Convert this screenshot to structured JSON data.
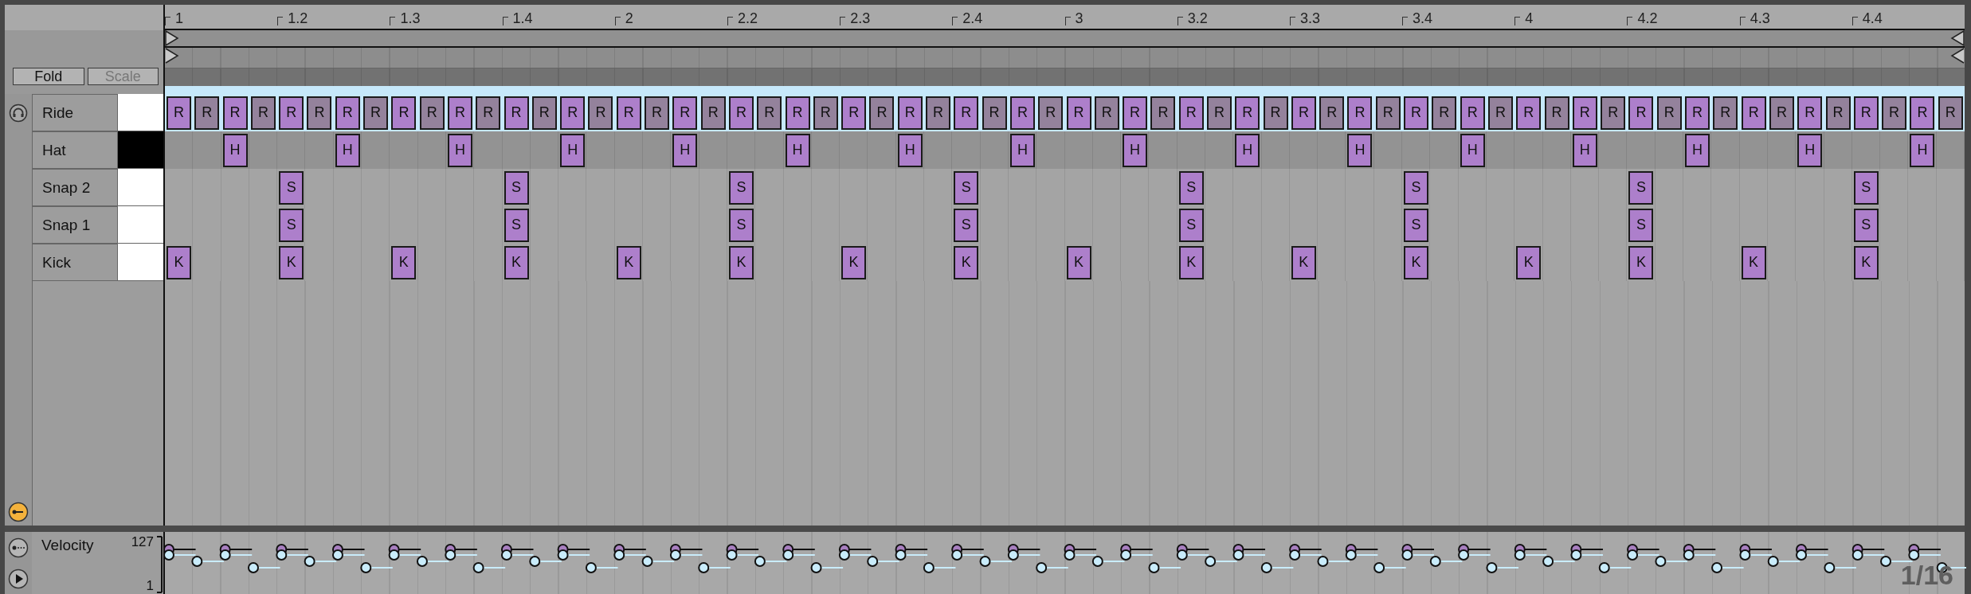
{
  "ruler": {
    "labels": [
      "1",
      "1.2",
      "1.3",
      "1.4",
      "2",
      "2.2",
      "2.3",
      "2.4",
      "3",
      "3.2",
      "3.3",
      "3.4",
      "4",
      "4.2",
      "4.3",
      "4.4"
    ]
  },
  "buttons": [
    {
      "label": "Fold",
      "disabled": false
    },
    {
      "label": "Scale",
      "disabled": true
    }
  ],
  "lanes": [
    {
      "name": "Ride",
      "kind": "white-key",
      "selected": true,
      "steps": [
        {
          "on": true,
          "label": "R",
          "dim": false
        },
        {
          "on": true,
          "label": "R",
          "dim": true
        },
        {
          "on": true,
          "label": "R",
          "dim": false
        },
        {
          "on": true,
          "label": "R",
          "dim": true
        },
        {
          "on": true,
          "label": "R",
          "dim": false
        },
        {
          "on": true,
          "label": "R",
          "dim": true
        },
        {
          "on": true,
          "label": "R",
          "dim": false
        },
        {
          "on": true,
          "label": "R",
          "dim": true
        },
        {
          "on": true,
          "label": "R",
          "dim": false
        },
        {
          "on": true,
          "label": "R",
          "dim": true
        },
        {
          "on": true,
          "label": "R",
          "dim": false
        },
        {
          "on": true,
          "label": "R",
          "dim": true
        },
        {
          "on": true,
          "label": "R",
          "dim": false
        },
        {
          "on": true,
          "label": "R",
          "dim": true
        },
        {
          "on": true,
          "label": "R",
          "dim": false
        },
        {
          "on": true,
          "label": "R",
          "dim": true
        },
        {
          "on": true,
          "label": "R",
          "dim": false
        },
        {
          "on": true,
          "label": "R",
          "dim": true
        },
        {
          "on": true,
          "label": "R",
          "dim": false
        },
        {
          "on": true,
          "label": "R",
          "dim": true
        },
        {
          "on": true,
          "label": "R",
          "dim": false
        },
        {
          "on": true,
          "label": "R",
          "dim": true
        },
        {
          "on": true,
          "label": "R",
          "dim": false
        },
        {
          "on": true,
          "label": "R",
          "dim": true
        },
        {
          "on": true,
          "label": "R",
          "dim": false
        },
        {
          "on": true,
          "label": "R",
          "dim": true
        },
        {
          "on": true,
          "label": "R",
          "dim": false
        },
        {
          "on": true,
          "label": "R",
          "dim": true
        },
        {
          "on": true,
          "label": "R",
          "dim": false
        },
        {
          "on": true,
          "label": "R",
          "dim": true
        },
        {
          "on": true,
          "label": "R",
          "dim": false
        },
        {
          "on": true,
          "label": "R",
          "dim": true
        },
        {
          "on": true,
          "label": "R",
          "dim": false
        },
        {
          "on": true,
          "label": "R",
          "dim": true
        },
        {
          "on": true,
          "label": "R",
          "dim": false
        },
        {
          "on": true,
          "label": "R",
          "dim": true
        },
        {
          "on": true,
          "label": "R",
          "dim": false
        },
        {
          "on": true,
          "label": "R",
          "dim": true
        },
        {
          "on": true,
          "label": "R",
          "dim": false
        },
        {
          "on": true,
          "label": "R",
          "dim": true
        },
        {
          "on": true,
          "label": "R",
          "dim": false
        },
        {
          "on": true,
          "label": "R",
          "dim": true
        },
        {
          "on": true,
          "label": "R",
          "dim": false
        },
        {
          "on": true,
          "label": "R",
          "dim": true
        },
        {
          "on": true,
          "label": "R",
          "dim": false
        },
        {
          "on": true,
          "label": "R",
          "dim": true
        },
        {
          "on": true,
          "label": "R",
          "dim": false
        },
        {
          "on": true,
          "label": "R",
          "dim": true
        },
        {
          "on": true,
          "label": "R",
          "dim": false
        },
        {
          "on": true,
          "label": "R",
          "dim": true
        },
        {
          "on": true,
          "label": "R",
          "dim": false
        },
        {
          "on": true,
          "label": "R",
          "dim": true
        },
        {
          "on": true,
          "label": "R",
          "dim": false
        },
        {
          "on": true,
          "label": "R",
          "dim": true
        },
        {
          "on": true,
          "label": "R",
          "dim": false
        },
        {
          "on": true,
          "label": "R",
          "dim": true
        },
        {
          "on": true,
          "label": "R",
          "dim": false
        },
        {
          "on": true,
          "label": "R",
          "dim": true
        },
        {
          "on": true,
          "label": "R",
          "dim": false
        },
        {
          "on": true,
          "label": "R",
          "dim": true
        },
        {
          "on": true,
          "label": "R",
          "dim": false
        },
        {
          "on": true,
          "label": "R",
          "dim": true
        },
        {
          "on": true,
          "label": "R",
          "dim": false
        },
        {
          "on": true,
          "label": "R",
          "dim": true
        }
      ]
    },
    {
      "name": "Hat",
      "kind": "black-key",
      "selected": false,
      "steps": [
        {
          "on": false
        },
        {
          "on": false
        },
        {
          "on": true,
          "label": "H"
        },
        {
          "on": false
        },
        {
          "on": false
        },
        {
          "on": false
        },
        {
          "on": true,
          "label": "H"
        },
        {
          "on": false
        },
        {
          "on": false
        },
        {
          "on": false
        },
        {
          "on": true,
          "label": "H"
        },
        {
          "on": false
        },
        {
          "on": false
        },
        {
          "on": false
        },
        {
          "on": true,
          "label": "H"
        },
        {
          "on": false
        },
        {
          "on": false
        },
        {
          "on": false
        },
        {
          "on": true,
          "label": "H"
        },
        {
          "on": false
        },
        {
          "on": false
        },
        {
          "on": false
        },
        {
          "on": true,
          "label": "H"
        },
        {
          "on": false
        },
        {
          "on": false
        },
        {
          "on": false
        },
        {
          "on": true,
          "label": "H"
        },
        {
          "on": false
        },
        {
          "on": false
        },
        {
          "on": false
        },
        {
          "on": true,
          "label": "H"
        },
        {
          "on": false
        },
        {
          "on": false
        },
        {
          "on": false
        },
        {
          "on": true,
          "label": "H"
        },
        {
          "on": false
        },
        {
          "on": false
        },
        {
          "on": false
        },
        {
          "on": true,
          "label": "H"
        },
        {
          "on": false
        },
        {
          "on": false
        },
        {
          "on": false
        },
        {
          "on": true,
          "label": "H"
        },
        {
          "on": false
        },
        {
          "on": false
        },
        {
          "on": false
        },
        {
          "on": true,
          "label": "H"
        },
        {
          "on": false
        },
        {
          "on": false
        },
        {
          "on": false
        },
        {
          "on": true,
          "label": "H"
        },
        {
          "on": false
        },
        {
          "on": false
        },
        {
          "on": false
        },
        {
          "on": true,
          "label": "H"
        },
        {
          "on": false
        },
        {
          "on": false
        },
        {
          "on": false
        },
        {
          "on": true,
          "label": "H"
        },
        {
          "on": false
        },
        {
          "on": false
        },
        {
          "on": false
        },
        {
          "on": true,
          "label": "H"
        },
        {
          "on": false
        }
      ]
    },
    {
      "name": "Snap 2",
      "kind": "white-key",
      "selected": false,
      "steps": [
        {
          "on": false
        },
        {
          "on": false
        },
        {
          "on": false
        },
        {
          "on": false
        },
        {
          "on": true,
          "label": "S"
        },
        {
          "on": false
        },
        {
          "on": false
        },
        {
          "on": false
        },
        {
          "on": false
        },
        {
          "on": false
        },
        {
          "on": false
        },
        {
          "on": false
        },
        {
          "on": true,
          "label": "S"
        },
        {
          "on": false
        },
        {
          "on": false
        },
        {
          "on": false
        },
        {
          "on": false
        },
        {
          "on": false
        },
        {
          "on": false
        },
        {
          "on": false
        },
        {
          "on": true,
          "label": "S"
        },
        {
          "on": false
        },
        {
          "on": false
        },
        {
          "on": false
        },
        {
          "on": false
        },
        {
          "on": false
        },
        {
          "on": false
        },
        {
          "on": false
        },
        {
          "on": true,
          "label": "S"
        },
        {
          "on": false
        },
        {
          "on": false
        },
        {
          "on": false
        },
        {
          "on": false
        },
        {
          "on": false
        },
        {
          "on": false
        },
        {
          "on": false
        },
        {
          "on": true,
          "label": "S"
        },
        {
          "on": false
        },
        {
          "on": false
        },
        {
          "on": false
        },
        {
          "on": false
        },
        {
          "on": false
        },
        {
          "on": false
        },
        {
          "on": false
        },
        {
          "on": true,
          "label": "S"
        },
        {
          "on": false
        },
        {
          "on": false
        },
        {
          "on": false
        },
        {
          "on": false
        },
        {
          "on": false
        },
        {
          "on": false
        },
        {
          "on": false
        },
        {
          "on": true,
          "label": "S"
        },
        {
          "on": false
        },
        {
          "on": false
        },
        {
          "on": false
        },
        {
          "on": false
        },
        {
          "on": false
        },
        {
          "on": false
        },
        {
          "on": false
        },
        {
          "on": true,
          "label": "S"
        },
        {
          "on": false
        },
        {
          "on": false
        },
        {
          "on": false
        }
      ]
    },
    {
      "name": "Snap 1",
      "kind": "white-key",
      "selected": false,
      "steps": [
        {
          "on": false
        },
        {
          "on": false
        },
        {
          "on": false
        },
        {
          "on": false
        },
        {
          "on": true,
          "label": "S"
        },
        {
          "on": false
        },
        {
          "on": false
        },
        {
          "on": false
        },
        {
          "on": false
        },
        {
          "on": false
        },
        {
          "on": false
        },
        {
          "on": false
        },
        {
          "on": true,
          "label": "S"
        },
        {
          "on": false
        },
        {
          "on": false
        },
        {
          "on": false
        },
        {
          "on": false
        },
        {
          "on": false
        },
        {
          "on": false
        },
        {
          "on": false
        },
        {
          "on": true,
          "label": "S"
        },
        {
          "on": false
        },
        {
          "on": false
        },
        {
          "on": false
        },
        {
          "on": false
        },
        {
          "on": false
        },
        {
          "on": false
        },
        {
          "on": false
        },
        {
          "on": true,
          "label": "S"
        },
        {
          "on": false
        },
        {
          "on": false
        },
        {
          "on": false
        },
        {
          "on": false
        },
        {
          "on": false
        },
        {
          "on": false
        },
        {
          "on": false
        },
        {
          "on": true,
          "label": "S"
        },
        {
          "on": false
        },
        {
          "on": false
        },
        {
          "on": false
        },
        {
          "on": false
        },
        {
          "on": false
        },
        {
          "on": false
        },
        {
          "on": false
        },
        {
          "on": true,
          "label": "S"
        },
        {
          "on": false
        },
        {
          "on": false
        },
        {
          "on": false
        },
        {
          "on": false
        },
        {
          "on": false
        },
        {
          "on": false
        },
        {
          "on": false
        },
        {
          "on": true,
          "label": "S"
        },
        {
          "on": false
        },
        {
          "on": false
        },
        {
          "on": false
        },
        {
          "on": false
        },
        {
          "on": false
        },
        {
          "on": false
        },
        {
          "on": false
        },
        {
          "on": true,
          "label": "S"
        },
        {
          "on": false
        },
        {
          "on": false
        },
        {
          "on": false
        }
      ]
    },
    {
      "name": "Kick",
      "kind": "white-key",
      "selected": false,
      "steps": [
        {
          "on": true,
          "label": "K"
        },
        {
          "on": false
        },
        {
          "on": false
        },
        {
          "on": false
        },
        {
          "on": true,
          "label": "K"
        },
        {
          "on": false
        },
        {
          "on": false
        },
        {
          "on": false
        },
        {
          "on": true,
          "label": "K"
        },
        {
          "on": false
        },
        {
          "on": false
        },
        {
          "on": false
        },
        {
          "on": true,
          "label": "K"
        },
        {
          "on": false
        },
        {
          "on": false
        },
        {
          "on": false
        },
        {
          "on": true,
          "label": "K"
        },
        {
          "on": false
        },
        {
          "on": false
        },
        {
          "on": false
        },
        {
          "on": true,
          "label": "K"
        },
        {
          "on": false
        },
        {
          "on": false
        },
        {
          "on": false
        },
        {
          "on": true,
          "label": "K"
        },
        {
          "on": false
        },
        {
          "on": false
        },
        {
          "on": false
        },
        {
          "on": true,
          "label": "K"
        },
        {
          "on": false
        },
        {
          "on": false
        },
        {
          "on": false
        },
        {
          "on": true,
          "label": "K"
        },
        {
          "on": false
        },
        {
          "on": false
        },
        {
          "on": false
        },
        {
          "on": true,
          "label": "K"
        },
        {
          "on": false
        },
        {
          "on": false
        },
        {
          "on": false
        },
        {
          "on": true,
          "label": "K"
        },
        {
          "on": false
        },
        {
          "on": false
        },
        {
          "on": false
        },
        {
          "on": true,
          "label": "K"
        },
        {
          "on": false
        },
        {
          "on": false
        },
        {
          "on": false
        },
        {
          "on": true,
          "label": "K"
        },
        {
          "on": false
        },
        {
          "on": false
        },
        {
          "on": false
        },
        {
          "on": true,
          "label": "K"
        },
        {
          "on": false
        },
        {
          "on": false
        },
        {
          "on": false
        },
        {
          "on": true,
          "label": "K"
        },
        {
          "on": false
        },
        {
          "on": false
        },
        {
          "on": false
        },
        {
          "on": true,
          "label": "K"
        },
        {
          "on": false
        },
        {
          "on": false
        },
        {
          "on": false
        }
      ]
    }
  ],
  "velocity": {
    "label": "Velocity",
    "max": "127",
    "min": "1"
  },
  "grid_label": "1/16"
}
